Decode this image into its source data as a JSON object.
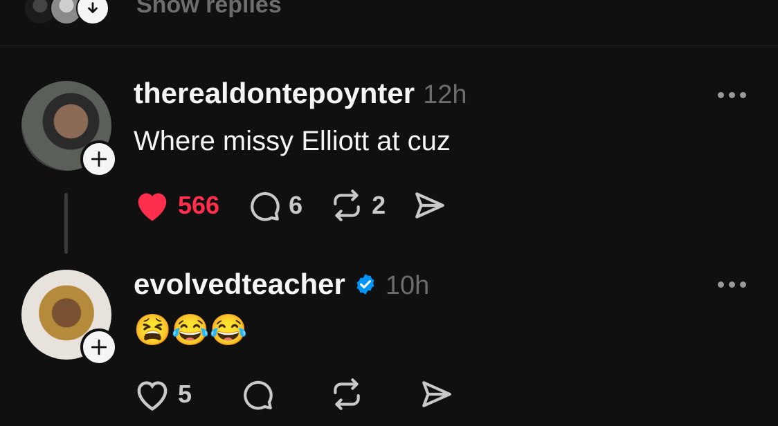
{
  "top": {
    "show_replies": "Show replies"
  },
  "posts": [
    {
      "username": "therealdontepoynter",
      "time": "12h",
      "text": "Where missy Elliott at cuz",
      "likes": "566",
      "comments": "6",
      "reposts": "2",
      "liked": true,
      "verified": false
    },
    {
      "username": "evolvedteacher",
      "time": "10h",
      "text": "😫😂😂",
      "likes": "5",
      "comments": "",
      "reposts": "",
      "liked": false,
      "verified": true
    }
  ],
  "colors": {
    "background": "#101010",
    "like_red": "#ff2e4c",
    "verified_blue": "#0095f6",
    "muted": "#6d6d6d"
  },
  "icons": [
    "heart-icon",
    "comment-icon",
    "repost-icon",
    "share-icon",
    "plus-icon",
    "more-icon",
    "verified-badge-icon",
    "arrow-down-icon"
  ]
}
